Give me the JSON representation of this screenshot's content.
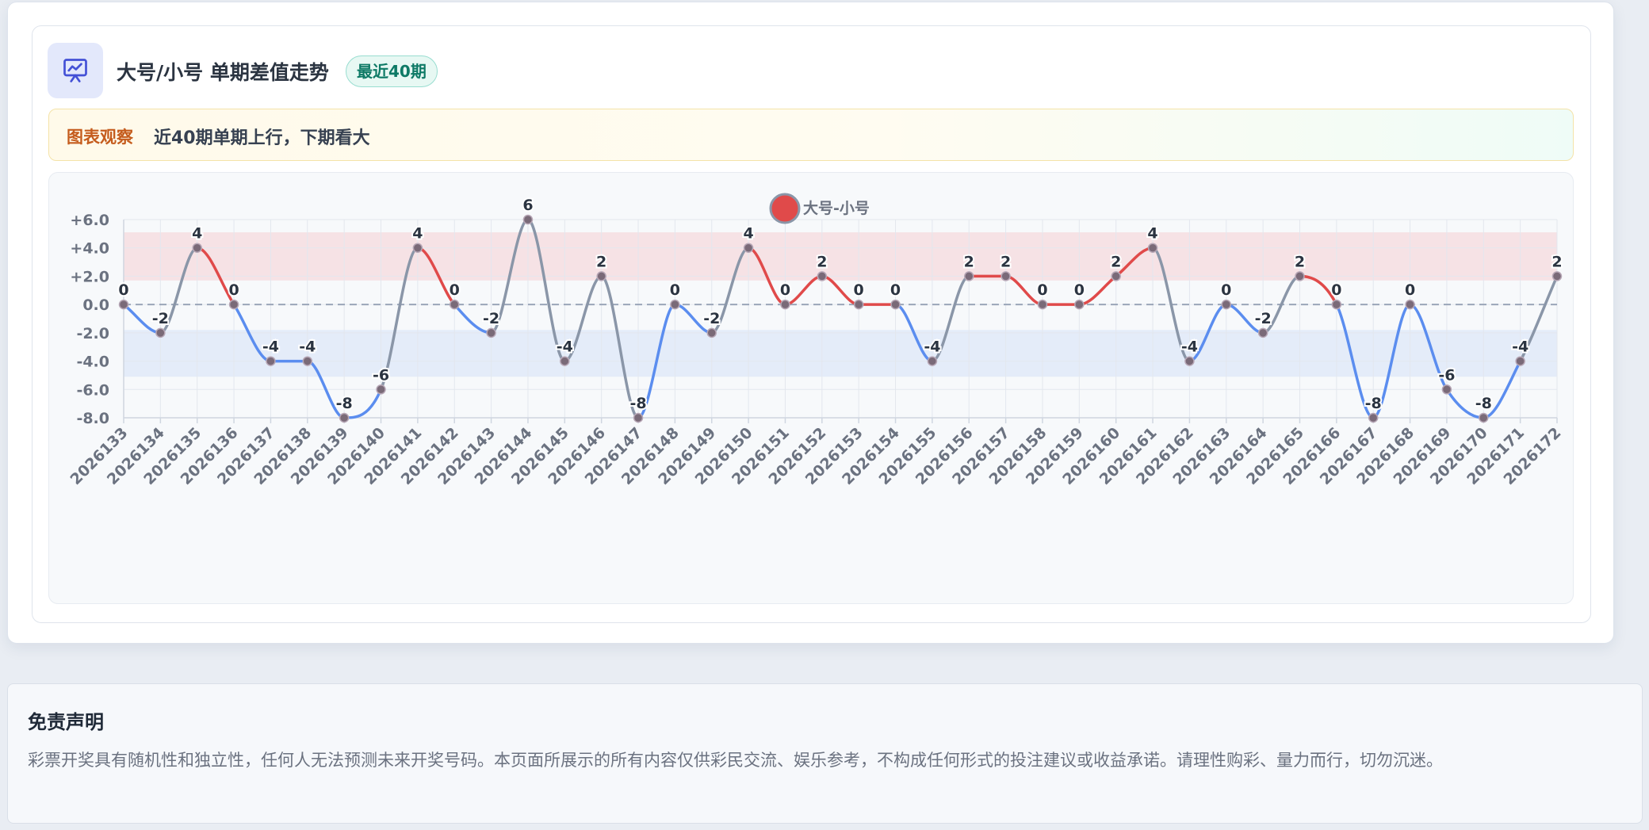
{
  "header": {
    "title": "大号/小号 单期差值走势",
    "badge": "最近40期",
    "icon": "presentation-chart-icon"
  },
  "observation": {
    "label": "图表观察",
    "text": "近40期单期上行，下期看大"
  },
  "chart_data": {
    "type": "line",
    "title": "",
    "xlabel": "",
    "ylabel": "",
    "smooth": true,
    "legend": {
      "position": "top-center",
      "label": "大号-小号"
    },
    "ylim": [
      -8,
      6
    ],
    "yticks": [
      "+6.0",
      "+4.0",
      "+2.0",
      "0.0",
      "-2.0",
      "-4.0",
      "-6.0",
      "-8.0"
    ],
    "reference_line": 0,
    "bands": [
      {
        "from": 1.7,
        "to": 5.1,
        "color": "#f5d9de"
      },
      {
        "from": -5.1,
        "to": -1.8,
        "color": "#dde7f8"
      }
    ],
    "colors": {
      "up": "#e04a4a",
      "down": "#5b8def",
      "mixed": "#8a96a8",
      "point": "#7a6a78"
    },
    "x": [
      "2026133",
      "2026134",
      "2026135",
      "2026136",
      "2026137",
      "2026138",
      "2026139",
      "2026140",
      "2026141",
      "2026142",
      "2026143",
      "2026144",
      "2026145",
      "2026146",
      "2026147",
      "2026148",
      "2026149",
      "2026150",
      "2026151",
      "2026152",
      "2026153",
      "2026154",
      "2026155",
      "2026156",
      "2026157",
      "2026158",
      "2026159",
      "2026160",
      "2026161",
      "2026162",
      "2026163",
      "2026164",
      "2026165",
      "2026166",
      "2026167",
      "2026168",
      "2026169",
      "2026170",
      "2026171",
      "2026172"
    ],
    "series": [
      {
        "name": "大号-小号",
        "values": [
          0,
          -2,
          4,
          0,
          -4,
          -4,
          -8,
          -6,
          4,
          0,
          -2,
          6,
          -4,
          2,
          -8,
          0,
          -2,
          4,
          0,
          2,
          0,
          0,
          -4,
          2,
          2,
          0,
          0,
          2,
          4,
          -4,
          0,
          -2,
          2,
          0,
          -8,
          0,
          -6,
          -8,
          -4,
          2
        ]
      }
    ]
  },
  "disclaimer": {
    "title": "免责声明",
    "body": "彩票开奖具有随机性和独立性，任何人无法预测未来开奖号码。本页面所展示的所有内容仅供彩民交流、娱乐参考，不构成任何形式的投注建议或收益承诺。请理性购彩、量力而行，切勿沉迷。"
  }
}
